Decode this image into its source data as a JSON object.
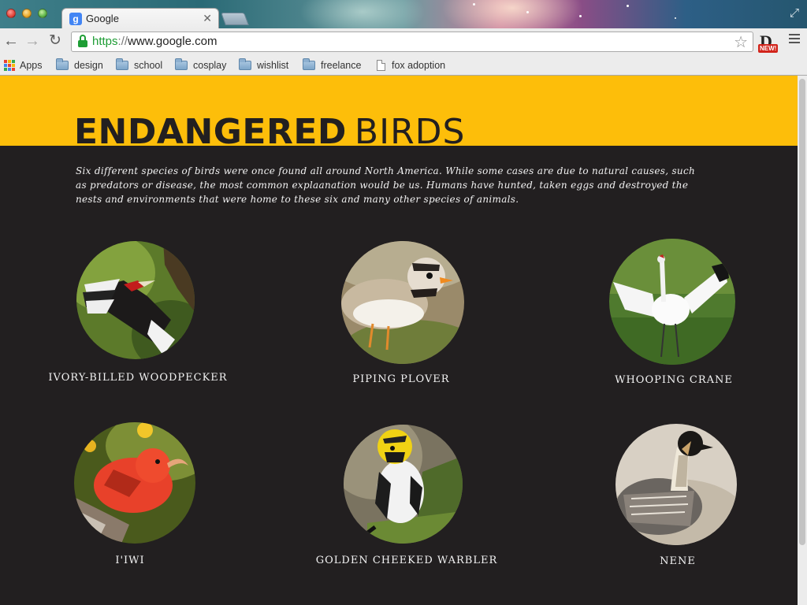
{
  "browser": {
    "tab_title": "Google",
    "tab_favicon": "g-logo-icon",
    "url_scheme": "https",
    "url_rest": "www.google.com",
    "bookmarks": [
      {
        "label": "Apps",
        "icon": "apps-grid-icon"
      },
      {
        "label": "design",
        "icon": "folder-icon"
      },
      {
        "label": "school",
        "icon": "folder-icon"
      },
      {
        "label": "cosplay",
        "icon": "folder-icon"
      },
      {
        "label": "wishlist",
        "icon": "folder-icon"
      },
      {
        "label": "freelance",
        "icon": "folder-icon"
      },
      {
        "label": "fox adoption",
        "icon": "page-icon"
      }
    ],
    "extension_badge": "NEW!"
  },
  "page": {
    "title_bold": "ENDANGERED",
    "title_light": "BIRDS",
    "intro": "Six different species of birds were once found all around North America. While some cases are due to natural causes, such as predators or disease, the most common explaanation would be us. Humans have hunted, taken eggs and destroyed the nests and environments that were home to these six and many other species of animals.",
    "colors": {
      "accent": "#fdbe0a",
      "background": "#221f20",
      "text": "#f3f3f3"
    },
    "birds": [
      {
        "name": "IVORY-BILLED WOODPECKER"
      },
      {
        "name": "PIPING PLOVER"
      },
      {
        "name": "WHOOPING CRANE"
      },
      {
        "name": "I'IWI"
      },
      {
        "name": "GOLDEN CHEEKED WARBLER"
      },
      {
        "name": "NENE"
      }
    ]
  }
}
